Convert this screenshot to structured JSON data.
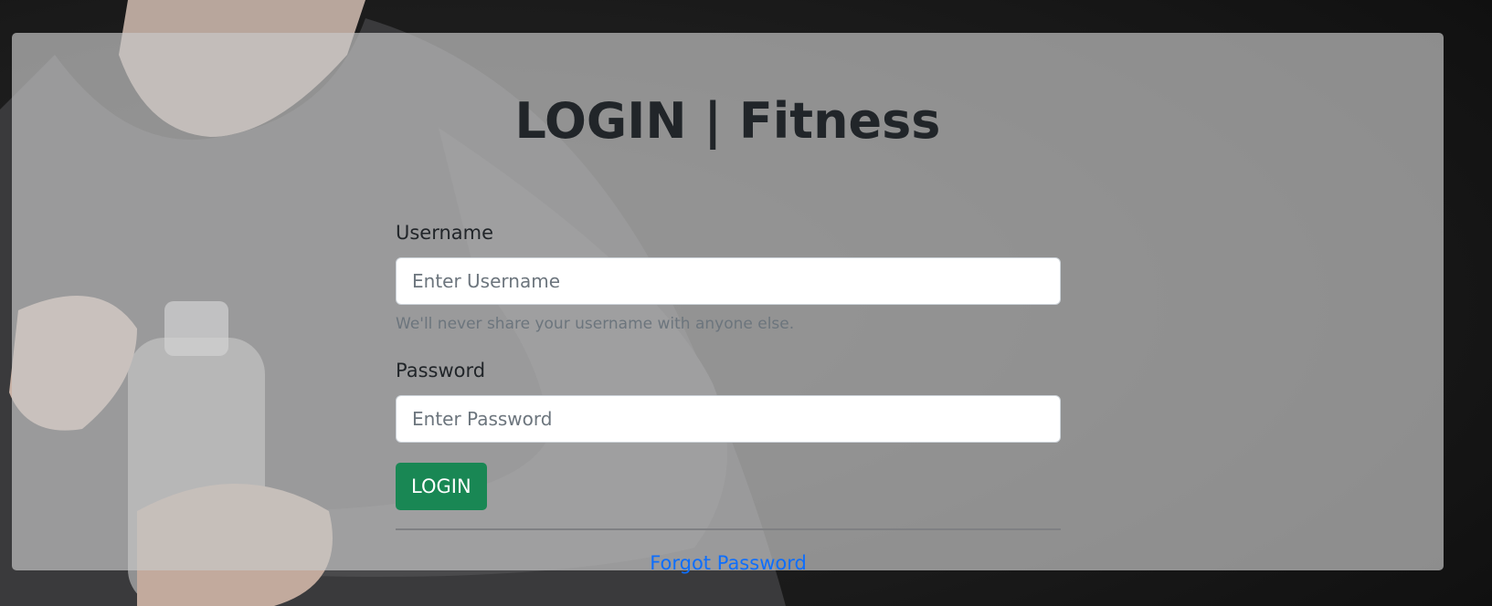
{
  "page": {
    "title": "LOGIN | Fitness"
  },
  "form": {
    "username": {
      "label": "Username",
      "placeholder": "Enter Username",
      "help_text": "We'll never share your username with anyone else."
    },
    "password": {
      "label": "Password",
      "placeholder": "Enter Password"
    },
    "submit_label": "LOGIN",
    "forgot_password_label": "Forgot Password"
  },
  "colors": {
    "button": "#198754",
    "link": "#0d6efd",
    "overlay": "#c8c8c8",
    "background": "#141414"
  }
}
